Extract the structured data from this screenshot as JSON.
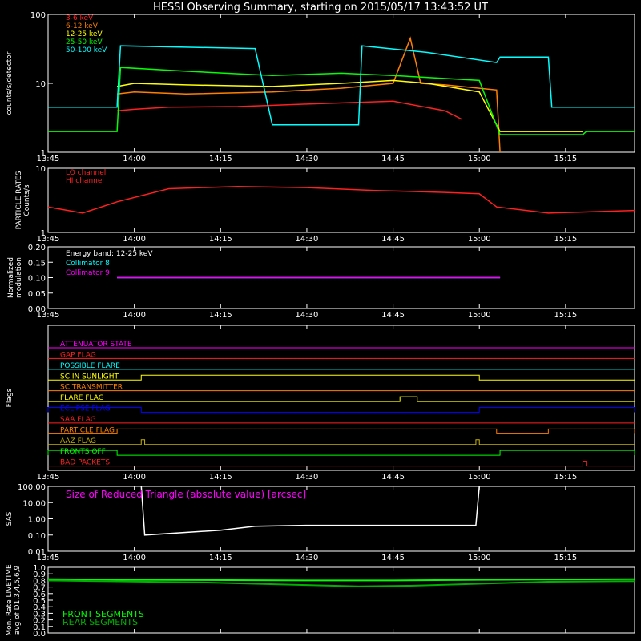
{
  "title": "HESSI Observing Summary, starting on 2015/05/17 13:43:52 UT",
  "time_ticks": [
    "13:45",
    "14:00",
    "14:15",
    "14:30",
    "14:45",
    "15:00",
    "15:15"
  ],
  "colors": {
    "red": "#ff2020",
    "orange": "#ff8000",
    "yellow": "#ffff00",
    "green": "#00ff00",
    "cyan": "#00ffff",
    "magenta": "#ff00ff",
    "blue": "#0000ff",
    "white": "#ffffff",
    "olive": "#c8b400",
    "dkgreen": "#00b000"
  },
  "chart_data": [
    {
      "id": "rates",
      "type": "line",
      "ylabel": "counts/s/detector",
      "yscale": "log",
      "ylim": [
        1,
        100
      ],
      "yticks": [
        "1",
        "10",
        "100"
      ],
      "series": [
        {
          "name": "3-6 keV",
          "color": "#ff2020",
          "points": [
            [
              13.95,
              4.0
            ],
            [
              14.0,
              4.2
            ],
            [
              14.1,
              4.5
            ],
            [
              14.3,
              4.6
            ],
            [
              14.5,
              5.0
            ],
            [
              14.75,
              5.5
            ],
            [
              14.9,
              4.0
            ],
            [
              14.95,
              3.0
            ]
          ]
        },
        {
          "name": "6-12 keV",
          "color": "#ff8000",
          "points": [
            [
              13.95,
              7.0
            ],
            [
              14.0,
              7.5
            ],
            [
              14.15,
              7.0
            ],
            [
              14.4,
              7.5
            ],
            [
              14.6,
              8.5
            ],
            [
              14.75,
              10.0
            ],
            [
              14.8,
              45.0
            ],
            [
              14.83,
              10.0
            ],
            [
              14.9,
              9.5
            ],
            [
              15.05,
              8.0
            ],
            [
              15.06,
              1.0
            ]
          ]
        },
        {
          "name": "12-25 keV",
          "color": "#ffff00",
          "points": [
            [
              13.95,
              9.0
            ],
            [
              14.0,
              10.0
            ],
            [
              14.15,
              9.5
            ],
            [
              14.4,
              9.0
            ],
            [
              14.6,
              10.0
            ],
            [
              14.75,
              11.0
            ],
            [
              14.85,
              10.0
            ],
            [
              15.0,
              7.5
            ],
            [
              15.06,
              2.0
            ],
            [
              15.3,
              2.0
            ]
          ]
        },
        {
          "name": "25-50 keV",
          "color": "#00ff00",
          "points": [
            [
              13.75,
              2.0
            ],
            [
              13.95,
              2.0
            ],
            [
              13.96,
              17.0
            ],
            [
              14.15,
              15.0
            ],
            [
              14.4,
              13.0
            ],
            [
              14.6,
              14.0
            ],
            [
              14.75,
              13.0
            ],
            [
              15.0,
              11.0
            ],
            [
              15.06,
              1.8
            ],
            [
              15.3,
              1.8
            ],
            [
              15.31,
              2.0
            ],
            [
              15.45,
              2.0
            ]
          ]
        },
        {
          "name": "50-100 keV",
          "color": "#00ffff",
          "points": [
            [
              13.75,
              4.5
            ],
            [
              13.95,
              4.5
            ],
            [
              13.96,
              35.0
            ],
            [
              14.35,
              32.0
            ],
            [
              14.4,
              2.5
            ],
            [
              14.65,
              2.5
            ],
            [
              14.66,
              35.0
            ],
            [
              14.85,
              28.0
            ],
            [
              15.05,
              20.0
            ],
            [
              15.06,
              24.0
            ],
            [
              15.2,
              24.0
            ],
            [
              15.21,
              4.5
            ],
            [
              15.45,
              4.5
            ]
          ]
        }
      ]
    },
    {
      "id": "particles",
      "type": "line",
      "ylabel": "PARTICLE RATES Counts/s",
      "yscale": "log",
      "ylim": [
        1,
        10
      ],
      "yticks": [
        "1",
        "10"
      ],
      "series": [
        {
          "name": "LO channel",
          "color": "#ff2020",
          "points": [
            [
              13.75,
              2.5
            ],
            [
              13.85,
              2.0
            ],
            [
              13.95,
              3.0
            ],
            [
              14.1,
              4.8
            ],
            [
              14.3,
              5.2
            ],
            [
              14.5,
              5.0
            ],
            [
              14.7,
              4.5
            ],
            [
              14.9,
              4.2
            ],
            [
              15.0,
              4.0
            ],
            [
              15.05,
              2.5
            ],
            [
              15.2,
              2.0
            ],
            [
              15.45,
              2.2
            ]
          ]
        },
        {
          "name": "HI channel",
          "color": "#ff2020",
          "points": []
        }
      ]
    },
    {
      "id": "modulation",
      "type": "line",
      "ylabel": "Normalized modulation",
      "ylim": [
        0.0,
        0.2
      ],
      "yticks": [
        "0.00",
        "0.05",
        "0.10",
        "0.15",
        "0.20"
      ],
      "annotation": "Energy band: 12-25 keV",
      "series": [
        {
          "name": "Collimator 8",
          "color": "#00ffff",
          "points": [
            [
              13.95,
              0.1
            ],
            [
              15.06,
              0.1
            ]
          ]
        },
        {
          "name": "Collimator 9",
          "color": "#ff00ff",
          "points": [
            [
              13.95,
              0.1
            ],
            [
              15.06,
              0.1
            ]
          ]
        }
      ]
    },
    {
      "id": "flags",
      "type": "line",
      "ylabel": "Flags",
      "flags": [
        {
          "name": "ATTENUATOR STATE",
          "color": "#ff00ff",
          "on": []
        },
        {
          "name": "GAP FLAG",
          "color": "#ff2020",
          "on": []
        },
        {
          "name": "POSSIBLE FLARE",
          "color": "#00ffff",
          "on": []
        },
        {
          "name": "SC IN SUNLIGHT",
          "color": "#ffff00",
          "on": [
            [
              14.02,
              15.0
            ]
          ]
        },
        {
          "name": "SC TRANSMITTER",
          "color": "#ff8000",
          "on": []
        },
        {
          "name": "FLARE FLAG",
          "color": "#ffff00",
          "on": [
            [
              14.77,
              14.82
            ]
          ]
        },
        {
          "name": "ECLIPSE FLAG",
          "color": "#0000ff",
          "on": [
            [
              13.75,
              14.02
            ],
            [
              15.0,
              15.45
            ]
          ]
        },
        {
          "name": "SAA FLAG",
          "color": "#ff2020",
          "on": []
        },
        {
          "name": "PARTICLE FLAG",
          "color": "#ff8000",
          "on": [
            [
              13.95,
              15.05
            ],
            [
              15.2,
              15.45
            ]
          ]
        },
        {
          "name": "AAZ FLAG",
          "color": "#c8b400",
          "on": [
            [
              14.02,
              14.03
            ],
            [
              14.99,
              15.0
            ]
          ]
        },
        {
          "name": "FRONTS OFF",
          "color": "#00ff00",
          "on": [
            [
              13.75,
              13.95
            ],
            [
              15.06,
              15.45
            ]
          ]
        },
        {
          "name": "BAD PACKETS",
          "color": "#ff2020",
          "on": [
            [
              15.3,
              15.31
            ]
          ]
        }
      ]
    },
    {
      "id": "sas",
      "type": "line",
      "ylabel": "SAS",
      "yscale": "log",
      "ylim": [
        0.01,
        100
      ],
      "yticks": [
        "0.01",
        "0.10",
        "1.00",
        "10.00",
        "100.00"
      ],
      "annotation": "Size of Reduced Triangle (absolute value) [arcsec]",
      "series": [
        {
          "name": "",
          "color": "#ffffff",
          "points": [
            [
              14.02,
              100
            ],
            [
              14.03,
              0.1
            ],
            [
              14.25,
              0.2
            ],
            [
              14.35,
              0.35
            ],
            [
              14.5,
              0.4
            ],
            [
              14.8,
              0.4
            ],
            [
              14.99,
              0.4
            ],
            [
              15.0,
              100
            ]
          ]
        }
      ]
    },
    {
      "id": "livetime",
      "type": "line",
      "ylabel": "Mon. Rate LIVETIME avg of D1,3,4,5,6,9",
      "ylim": [
        0.0,
        1.0
      ],
      "yticks": [
        "0.0",
        "0.1",
        "0.2",
        "0.3",
        "0.4",
        "0.5",
        "0.6",
        "0.7",
        "0.8",
        "0.9",
        "1.0"
      ],
      "series": [
        {
          "name": "FRONT SEGMENTS",
          "color": "#00ff00",
          "points": [
            [
              13.75,
              0.82
            ],
            [
              14.0,
              0.81
            ],
            [
              14.5,
              0.8
            ],
            [
              14.75,
              0.8
            ],
            [
              15.0,
              0.81
            ],
            [
              15.45,
              0.82
            ]
          ]
        },
        {
          "name": "REAR SEGMENTS",
          "color": "#00b000",
          "points": [
            [
              13.75,
              0.8
            ],
            [
              13.9,
              0.79
            ],
            [
              14.2,
              0.77
            ],
            [
              14.5,
              0.73
            ],
            [
              14.65,
              0.71
            ],
            [
              14.8,
              0.72
            ],
            [
              15.0,
              0.75
            ],
            [
              15.2,
              0.78
            ],
            [
              15.45,
              0.79
            ]
          ]
        }
      ]
    }
  ]
}
